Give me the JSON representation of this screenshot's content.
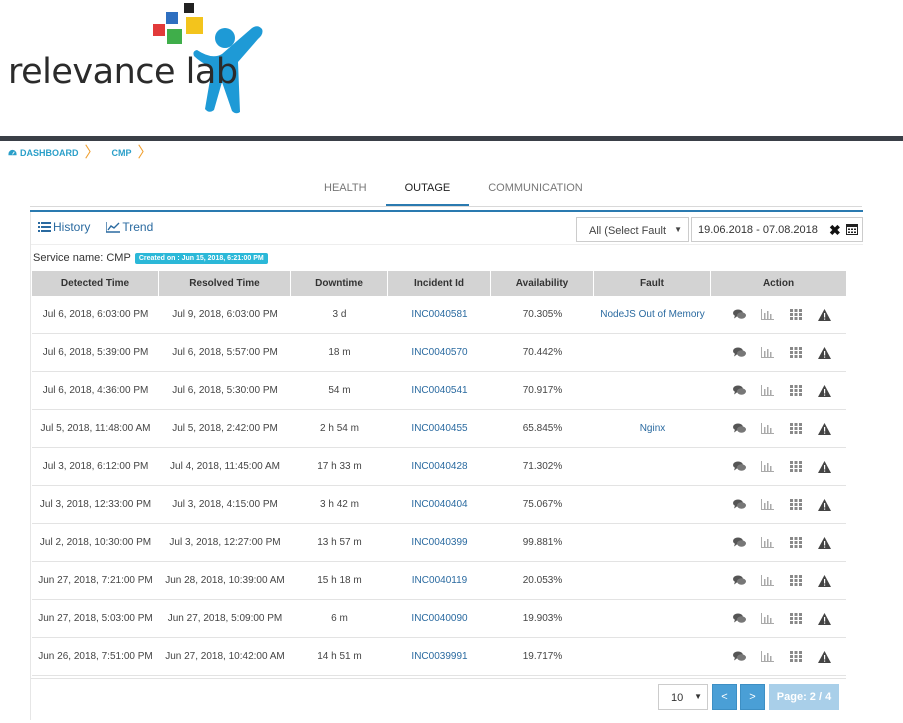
{
  "brand": {
    "logo_text": "relevance lab"
  },
  "breadcrumb": {
    "items": [
      "DASHBOARD",
      "CMP"
    ]
  },
  "tabs": [
    {
      "label": "HEALTH",
      "active": false
    },
    {
      "label": "OUTAGE",
      "active": true
    },
    {
      "label": "COMMUNICATION",
      "active": false
    }
  ],
  "toolbar": {
    "history_label": "History",
    "trend_label": "Trend"
  },
  "filters": {
    "fault_select": "All (Select Fault",
    "date_range": "19.06.2018 - 07.08.2018"
  },
  "service": {
    "label": "Service name: CMP",
    "created": "Created on : Jun 15, 2018, 6:21:00 PM"
  },
  "table": {
    "columns": [
      "Detected Time",
      "Resolved Time",
      "Downtime",
      "Incident Id",
      "Availability",
      "Fault",
      "Action"
    ],
    "rows": [
      [
        "Jul 6, 2018, 6:03:00 PM",
        "Jul 9, 2018, 6:03:00 PM",
        "3 d",
        "INC0040581",
        "70.305%",
        "NodeJS Out of Memory"
      ],
      [
        "Jul 6, 2018, 5:39:00 PM",
        "Jul 6, 2018, 5:57:00 PM",
        "18 m",
        "INC0040570",
        "70.442%",
        ""
      ],
      [
        "Jul 6, 2018, 4:36:00 PM",
        "Jul 6, 2018, 5:30:00 PM",
        "54 m",
        "INC0040541",
        "70.917%",
        ""
      ],
      [
        "Jul 5, 2018, 11:48:00 AM",
        "Jul 5, 2018, 2:42:00 PM",
        "2 h 54 m",
        "INC0040455",
        "65.845%",
        "Nginx"
      ],
      [
        "Jul 3, 2018, 6:12:00 PM",
        "Jul 4, 2018, 11:45:00 AM",
        "17 h 33 m",
        "INC0040428",
        "71.302%",
        ""
      ],
      [
        "Jul 3, 2018, 12:33:00 PM",
        "Jul 3, 2018, 4:15:00 PM",
        "3 h 42 m",
        "INC0040404",
        "75.067%",
        ""
      ],
      [
        "Jul 2, 2018, 10:30:00 PM",
        "Jul 3, 2018, 12:27:00 PM",
        "13 h 57 m",
        "INC0040399",
        "99.881%",
        ""
      ],
      [
        "Jun 27, 2018, 7:21:00 PM",
        "Jun 28, 2018, 10:39:00 AM",
        "15 h 18 m",
        "INC0040119",
        "20.053%",
        ""
      ],
      [
        "Jun 27, 2018, 5:03:00 PM",
        "Jun 27, 2018, 5:09:00 PM",
        "6 m",
        "INC0040090",
        "19.903%",
        ""
      ],
      [
        "Jun 26, 2018, 7:51:00 PM",
        "Jun 27, 2018, 10:42:00 AM",
        "14 h 51 m",
        "INC0039991",
        "19.717%",
        ""
      ]
    ],
    "action_icons": [
      "comment-icon",
      "bar-chart-icon",
      "grid-icon",
      "warning-icon"
    ]
  },
  "pagination": {
    "per_page": "10",
    "prev": "<",
    "next": ">",
    "page_label": "Page: 2 / 4"
  },
  "colors": {
    "accent": "#2a7ab0",
    "link": "#2a6aa0",
    "badge": "#2bb8d8",
    "header_bar": "#3a3f47"
  }
}
